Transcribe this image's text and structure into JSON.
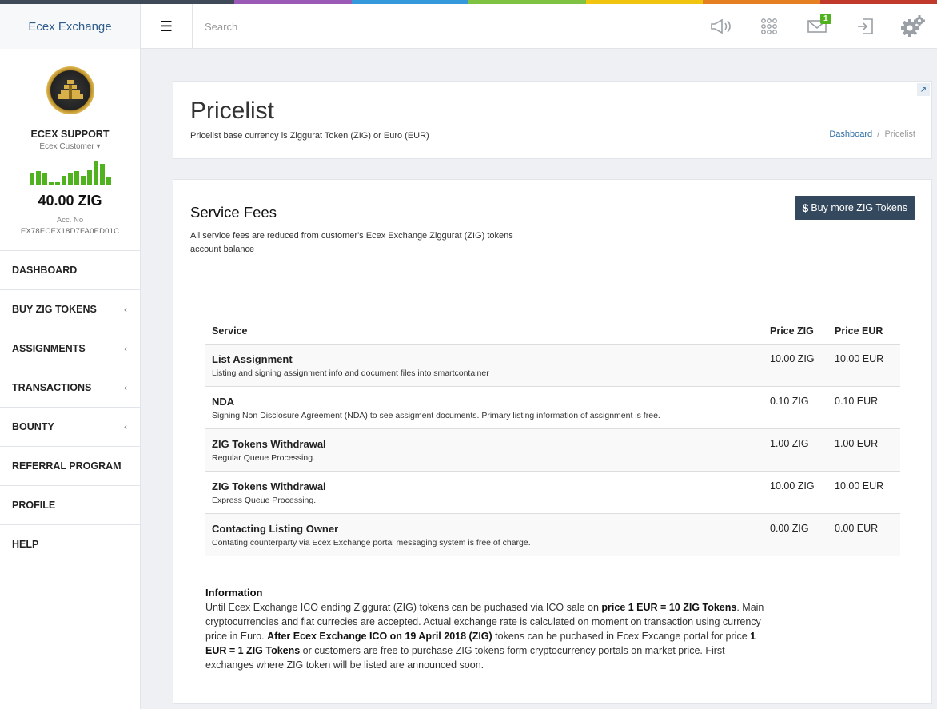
{
  "colors": {
    "stripe": [
      "#3f4a59",
      "#3f4a59",
      "#9b59b6",
      "#3498db",
      "#7fc242",
      "#f1c40f",
      "#e67e22",
      "#c0392b"
    ],
    "accent_green": "#51b21f",
    "link_blue": "#2e6da4",
    "button_dark": "#34495e"
  },
  "topbar": {
    "brand": "Ecex Exchange",
    "menu_icon": "hamburger-icon",
    "search_placeholder": "Search",
    "icons": [
      "megaphone-icon",
      "apps-grid-icon",
      "envelope-icon",
      "sign-in-icon",
      "gears-icon"
    ],
    "mail_badge": "1"
  },
  "sidebar": {
    "user_name": "ECEX SUPPORT",
    "user_role": "Ecex Customer",
    "activity_levels": [
      0.5,
      0.55,
      0.45,
      0.1,
      0.1,
      0.35,
      0.45,
      0.55,
      0.35,
      0.6,
      0.95,
      0.85,
      0.3
    ],
    "balance": "40.00 ZIG",
    "acc_label": "Acc. No",
    "acc_no": "EX78ECEX18D7FA0ED01C",
    "items": [
      {
        "label": "DASHBOARD",
        "submenu": false
      },
      {
        "label": "BUY ZIG TOKENS",
        "submenu": true
      },
      {
        "label": "ASSIGNMENTS",
        "submenu": true
      },
      {
        "label": "TRANSACTIONS",
        "submenu": true
      },
      {
        "label": "BOUNTY",
        "submenu": true
      },
      {
        "label": "REFERRAL PROGRAM",
        "submenu": false
      },
      {
        "label": "PROFILE",
        "submenu": false
      },
      {
        "label": "HELP",
        "submenu": false
      }
    ]
  },
  "header": {
    "title": "Pricelist",
    "subtitle": "Pricelist base currency is Ziggurat Token (ZIG) or Euro (EUR)",
    "breadcrumb": {
      "home": "Dashboard",
      "sep": "/",
      "current": "Pricelist"
    }
  },
  "fees": {
    "title": "Service Fees",
    "description": "All service fees are reduced from customer's Ecex Exchange Ziggurat (ZIG) tokens account balance",
    "buy_button": "Buy more ZIG Tokens",
    "columns": {
      "service": "Service",
      "price_zig": "Price ZIG",
      "price_eur": "Price EUR"
    },
    "rows": [
      {
        "name": "List Assignment",
        "desc": "Listing and signing assignment info and document files into smartcontainer",
        "zig": "10.00 ZIG",
        "eur": "10.00 EUR"
      },
      {
        "name": "NDA",
        "desc": "Signing Non Disclosure Agreement (NDA) to see assigment documents. Primary listing information of assignment is free.",
        "zig": "0.10 ZIG",
        "eur": "0.10 EUR"
      },
      {
        "name": "ZIG Tokens Withdrawal",
        "desc": "Regular Queue Processing.",
        "zig": "1.00 ZIG",
        "eur": "1.00 EUR"
      },
      {
        "name": "ZIG Tokens Withdrawal",
        "desc": "Express Queue Processing.",
        "zig": "10.00 ZIG",
        "eur": "10.00 EUR"
      },
      {
        "name": "Contacting Listing Owner",
        "desc": "Contating counterparty via Ecex Exchange portal messaging system is free of charge.",
        "zig": "0.00 ZIG",
        "eur": "0.00 EUR"
      }
    ]
  },
  "info": {
    "title": "Information",
    "t1": "Until Ecex Exchange ICO ending Ziggurat (ZIG) tokens can be puchased via ICO sale on ",
    "b1": "price 1 EUR = 10 ZIG Tokens",
    "t2": ". Main cryptocurrencies and fiat curreci­es are accepted. Actual exchange rate is calculated on moment on transaction using currency price in Euro. ",
    "b2": "After Ecex Exchange ICO on 19 April 2018 (ZIG)",
    "t3": " tokens can be puchased in Ecex Excange portal for price ",
    "b3": "1 EUR = 1 ZIG Tokens",
    "t4": " or customers are free to purchase ZIG tokens form cryptocurrency portals on market price. First exchanges where ZIG token will be listed are announced soon."
  }
}
